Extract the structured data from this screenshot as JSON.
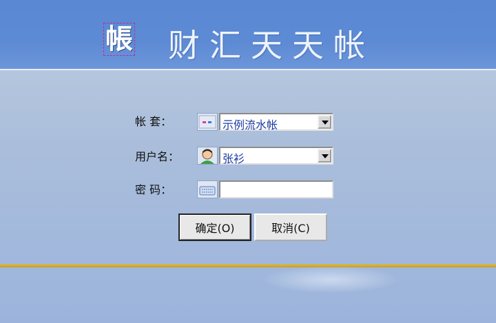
{
  "app": {
    "logo_char": "帳",
    "title": "财汇天天帐"
  },
  "form": {
    "account_set": {
      "label": "帐  套：",
      "value": "示例流水帐",
      "icon": "ledger-icon"
    },
    "user": {
      "label": "用户名：",
      "value": "张衫",
      "icon": "user-avatar-icon"
    },
    "password": {
      "label": "密  码：",
      "value": "",
      "icon": "keyboard-icon"
    }
  },
  "buttons": {
    "ok": "确定(O)",
    "cancel": "取消(C)"
  },
  "colors": {
    "header": "#5a88d2",
    "accent_rule": "#e0b019",
    "text_value": "#1a3aa0"
  }
}
